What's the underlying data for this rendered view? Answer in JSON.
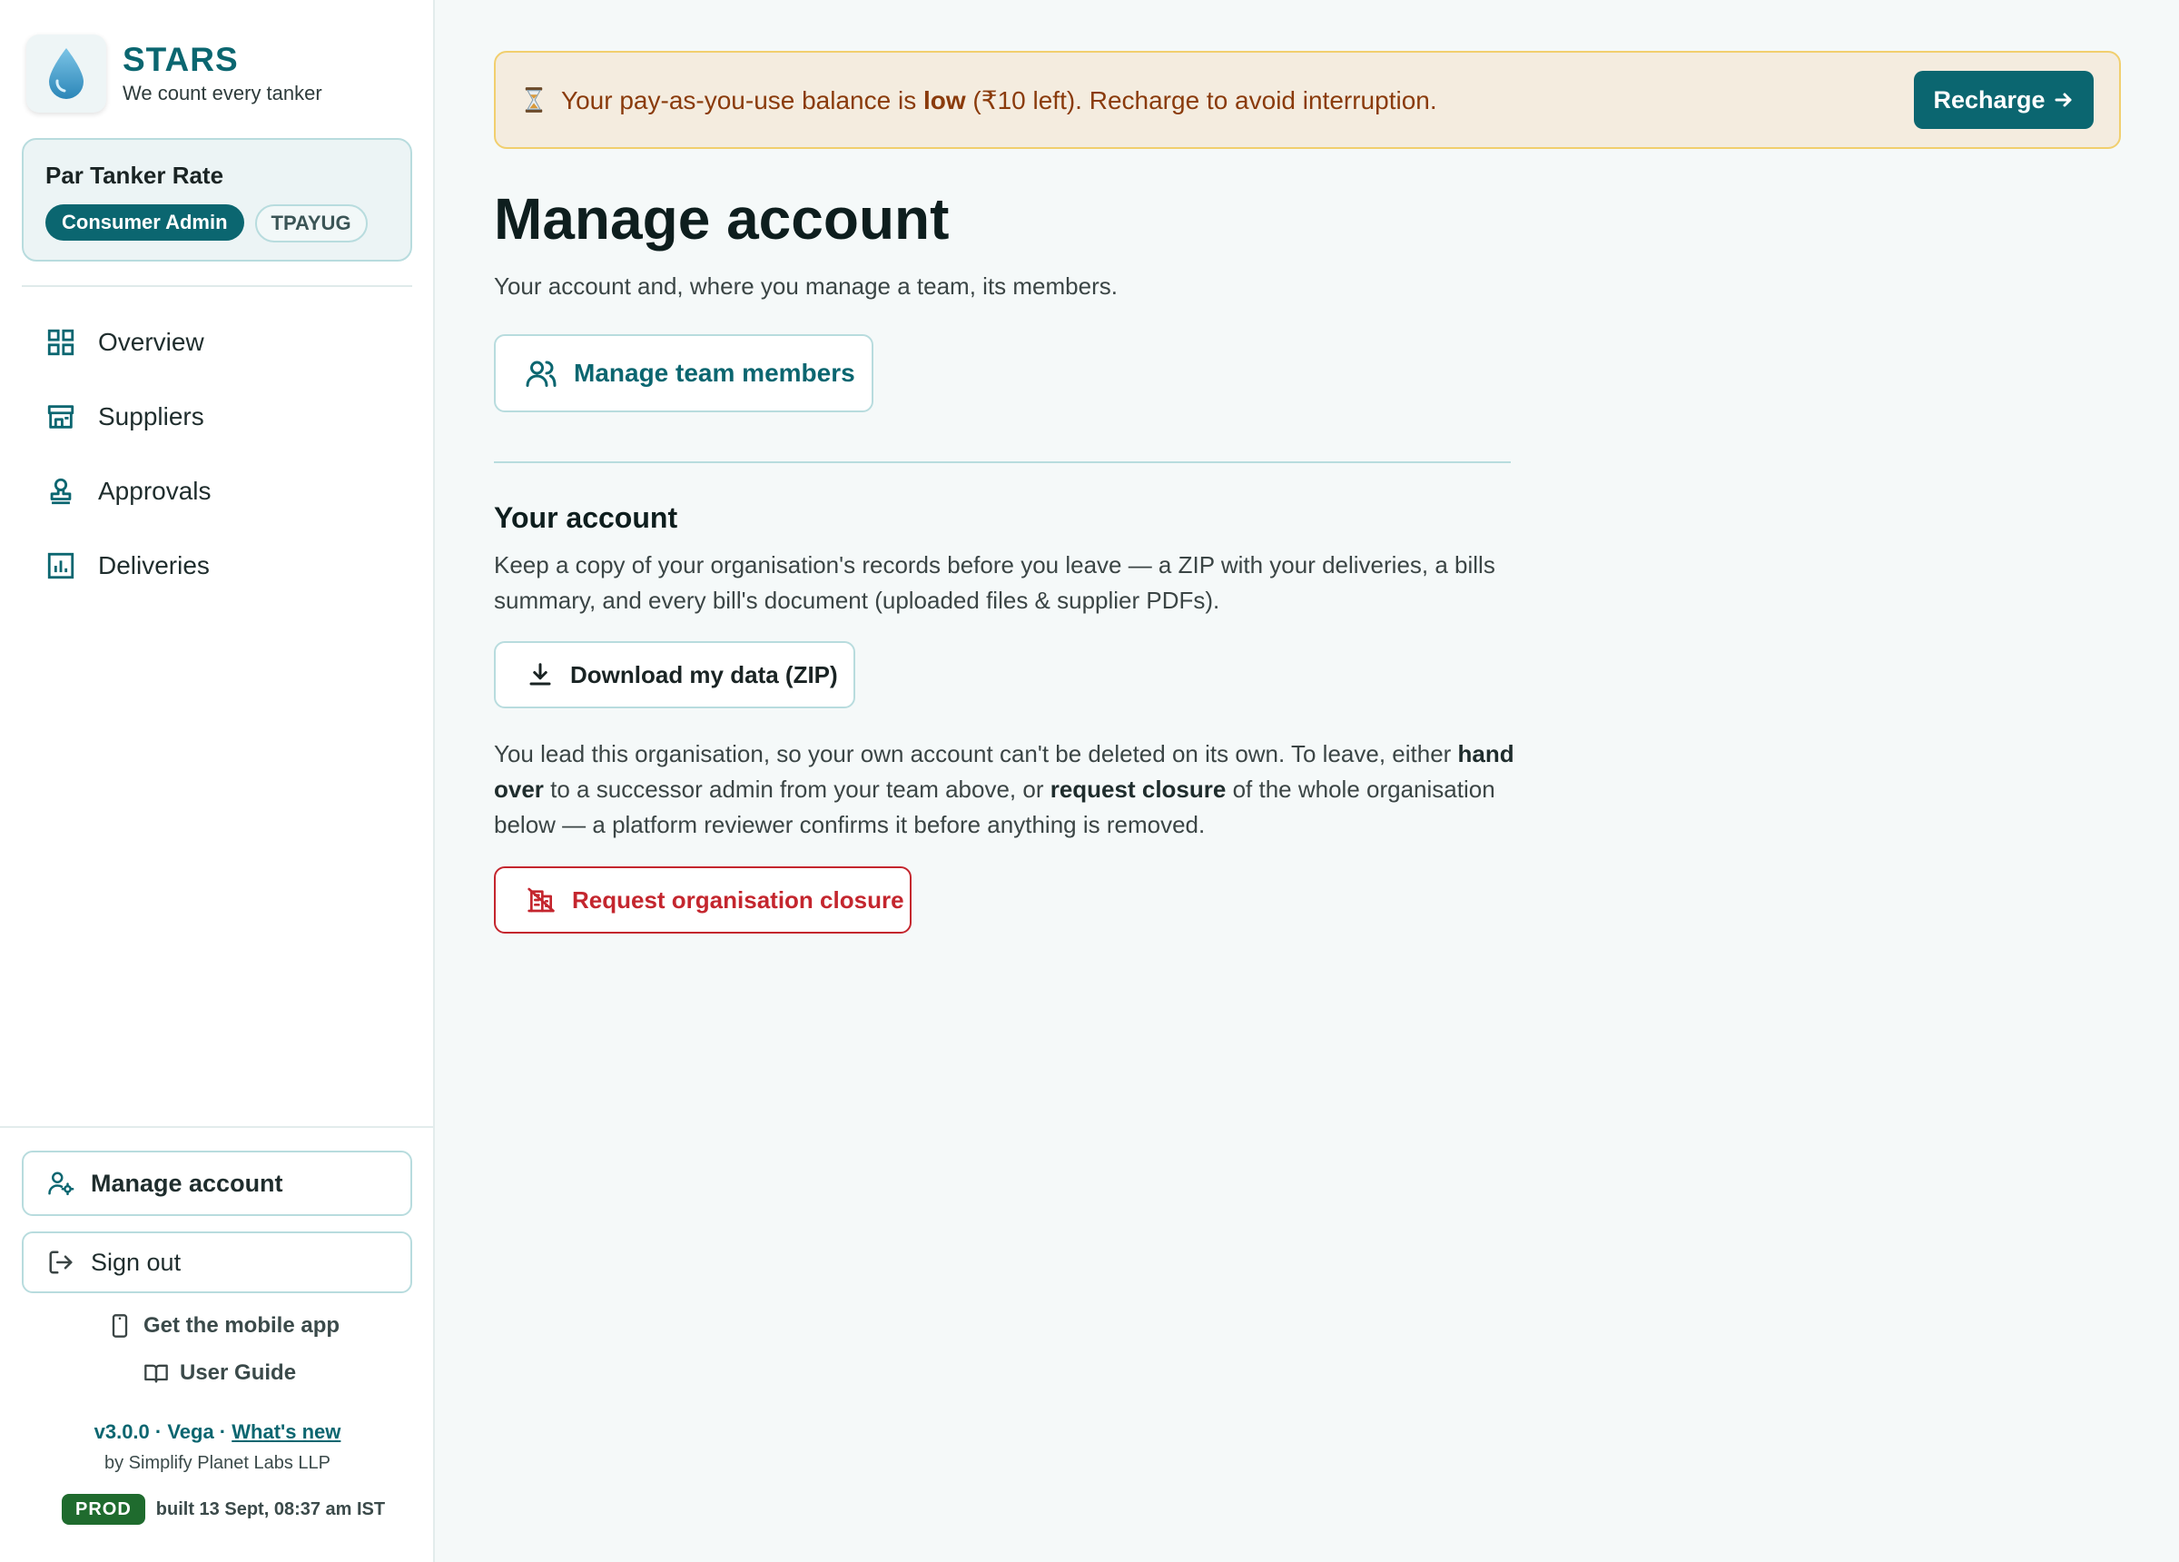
{
  "colors": {
    "brand": "#0b6670",
    "alert_bg": "#f4ecdf",
    "alert_border": "#f1cf6e",
    "alert_text": "#8a3b0c",
    "danger": "#c4262e",
    "prod_badge": "#1f6b2e"
  },
  "brand": {
    "name": "STARS",
    "tagline": "We count every tanker",
    "logo_icon": "water-drop-icon"
  },
  "org": {
    "name": "Par Tanker Rate",
    "role": "Consumer Admin",
    "code": "TPAYUG"
  },
  "nav": {
    "items": [
      {
        "label": "Overview",
        "icon": "grid-icon"
      },
      {
        "label": "Suppliers",
        "icon": "store-icon"
      },
      {
        "label": "Approvals",
        "icon": "stamp-icon"
      },
      {
        "label": "Deliveries",
        "icon": "bar-chart-icon"
      }
    ]
  },
  "sidebar_footer": {
    "manage_account": "Manage account",
    "sign_out": "Sign out",
    "mobile_app": "Get the mobile app",
    "user_guide": "User Guide",
    "version": "v3.0.0 · Vega · ",
    "whats_new": "What's new",
    "byline": "by Simplify Planet Labs LLP",
    "env_badge": "PROD",
    "build": "built 13 Sept, 08:37 am IST"
  },
  "alert": {
    "icon": "hourglass-icon",
    "text_before": "Your pay-as-you-use balance is ",
    "text_bold": "low",
    "text_after": " (₹10 left). Recharge to avoid interruption.",
    "button": "Recharge"
  },
  "main": {
    "title": "Manage account",
    "subtitle": "Your account and, where you manage a team, its members.",
    "team_button": "Manage team members",
    "section_title": "Your account",
    "export_text": "Keep a copy of your organisation's records before you leave — a ZIP with your deliveries, a bills summary, and every bill's document (uploaded files & supplier PDFs).",
    "download_button": "Download my data (ZIP)",
    "leave_text_1": "You lead this organisation, so your own account can't be deleted on its own. To leave, either ",
    "leave_bold_1": "hand over",
    "leave_text_2": " to a successor admin from your team above, or ",
    "leave_bold_2": "request closure",
    "leave_text_3": " of the whole organisation below — a platform reviewer confirms it before anything is removed.",
    "closure_button": "Request organisation closure"
  }
}
